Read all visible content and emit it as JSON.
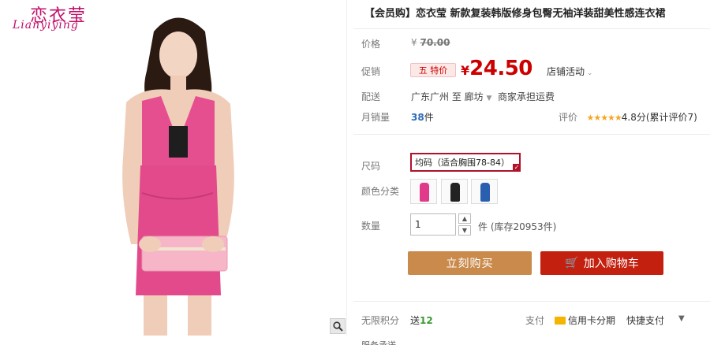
{
  "brand": {
    "name_cn": "恋衣莹",
    "name_en": "Lianyiying"
  },
  "product": {
    "title": "【会员购】恋衣莹 新款复装韩版修身包臀无袖洋装甜美性感连衣裙",
    "price_label": "价格",
    "original_price_prefix": "¥",
    "original_price": "70.00",
    "promo_label": "促销",
    "promo_badge": "五 特价",
    "promo_price_prefix": "¥",
    "promo_price": "24.50",
    "shop_activity": "店铺活动",
    "shipping_label": "配送",
    "shipping_text": "广东广州 至 廊坊",
    "shipping_note": "商家承担运费",
    "sales_label": "月销量",
    "sales_count": "38",
    "sales_unit": "件",
    "review_label": "评价",
    "rating_stars": "★★★★★",
    "rating_text": "4.8分(累计评价7)",
    "size_label": "尺码",
    "size_selected": "均码（适合胸围78-84）",
    "color_label": "颜色分类",
    "color_swatches": [
      "#e03a8a",
      "#222222",
      "#2a5fb0"
    ],
    "qty_label": "数量",
    "qty_value": "1",
    "stock_text": "件 (库存20953件)",
    "buy_now": "立刻购买",
    "add_cart": "加入购物车",
    "points_label": "无限积分",
    "points_prefix": "送",
    "points_value": "12",
    "pay_label": "支付",
    "pay_card": "信用卡分期",
    "pay_fast": "快捷支付",
    "bottom_peek": "服务承诺"
  }
}
